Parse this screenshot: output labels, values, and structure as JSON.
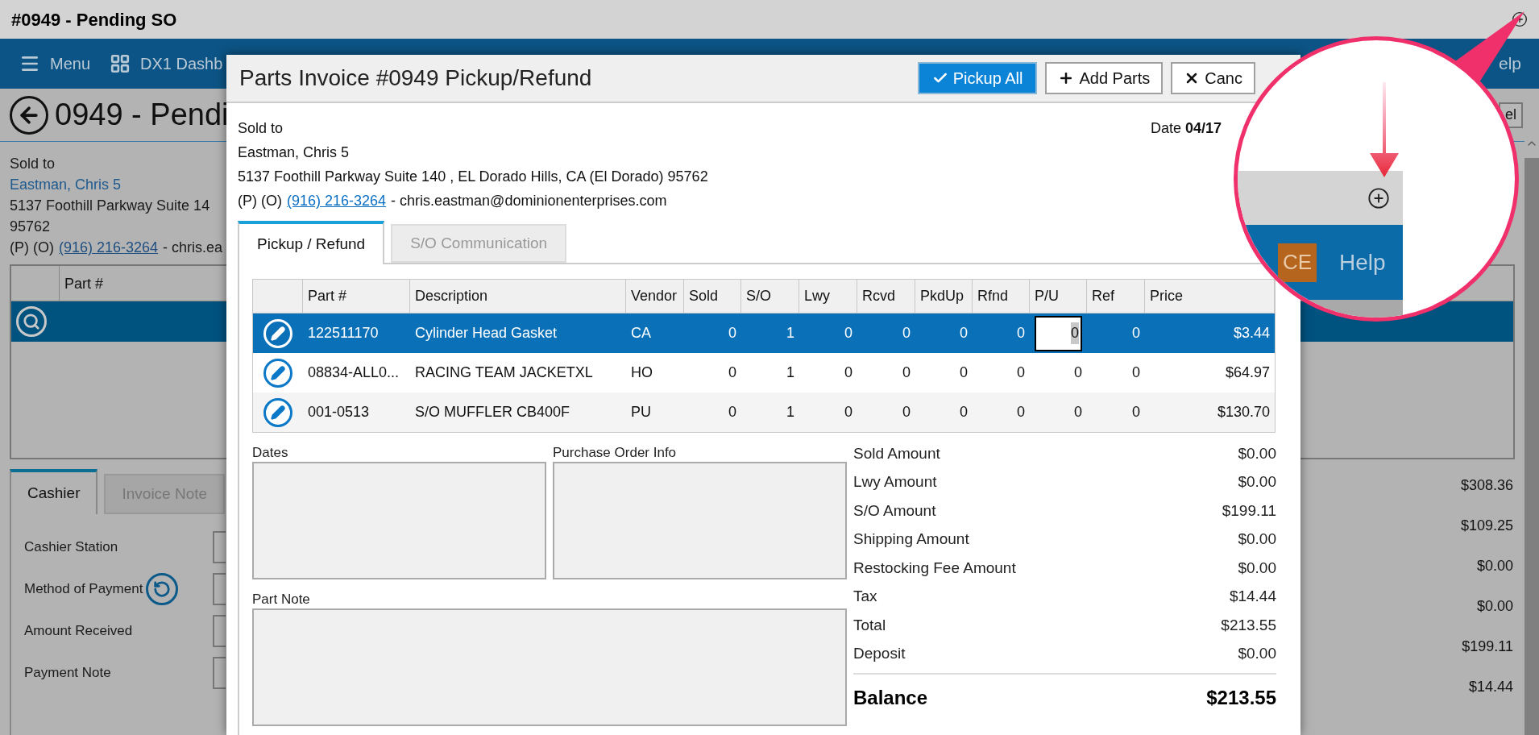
{
  "window": {
    "title": "#0949 - Pending SO"
  },
  "nav": {
    "items": [
      {
        "label": "Menu"
      },
      {
        "label": "DX1 Dashb"
      }
    ],
    "help_fragment": "elp"
  },
  "page": {
    "heading": "0949 - Pendi",
    "cancel_fragment": "el",
    "sold_to": {
      "label": "Sold to",
      "name": "Eastman, Chris 5",
      "address": "5137 Foothill Parkway Suite 14",
      "zip": "95762",
      "phone_prefix": "(P) (O)",
      "phone": "(916) 216-3264",
      "email": "- chris.ea"
    },
    "parts_table": {
      "columns": [
        "Part #"
      ]
    },
    "tabs": [
      {
        "label": "Cashier",
        "selected": true
      },
      {
        "label": "Invoice Note",
        "selected": false
      }
    ],
    "fields": [
      {
        "label": "Cashier Station",
        "kind": "plain"
      },
      {
        "label": "Method of Payment",
        "kind": "refresh"
      },
      {
        "label": "Amount Received",
        "kind": "plain"
      },
      {
        "label": "Payment Note",
        "kind": "plain"
      }
    ],
    "summary_values": [
      "$308.36",
      "$109.25",
      "$0.00",
      "$0.00",
      "$199.11",
      "$14.44"
    ]
  },
  "dialog": {
    "title": "Parts Invoice #0949 Pickup/Refund",
    "buttons": [
      {
        "label": "Pickup All",
        "primary": true
      },
      {
        "label": "Add Parts",
        "primary": false
      },
      {
        "label": "Canc",
        "primary": false
      }
    ],
    "sold_to": {
      "label": "Sold to",
      "name": "Eastman, Chris 5",
      "address": "5137 Foothill Parkway Suite 140 , EL Dorado Hills, CA (El Dorado) 95762",
      "phone_prefix": "(P) (O)",
      "phone": "(916) 216-3264",
      "email": "- chris.eastman@dominionenterprises.com"
    },
    "date": "Date **04/17**",
    "tabs": [
      {
        "label": "Pickup / Refund",
        "selected": true
      },
      {
        "label": "S/O Communication",
        "selected": false
      }
    ],
    "table": {
      "columns": [
        "Part #",
        "Description",
        "Vendor",
        "Sold",
        "S/O",
        "Lwy",
        "Rcvd",
        "PkdUp",
        "Rfnd",
        "P/U",
        "Ref",
        "Price"
      ],
      "rows": [
        {
          "selected": true,
          "cells": [
            "122511170",
            "Cylinder Head Gasket",
            "CA",
            "0",
            "1",
            "0",
            "0",
            "0",
            "0",
            "0",
            "0",
            "$3.44"
          ]
        },
        {
          "selected": false,
          "cells": [
            "08834-ALL0...",
            "RACING TEAM JACKETXL",
            "HO",
            "0",
            "1",
            "0",
            "0",
            "0",
            "0",
            "0",
            "0",
            "$64.97"
          ]
        },
        {
          "selected": false,
          "cells": [
            "001-0513",
            "S/O MUFFLER CB400F",
            "PU",
            "0",
            "1",
            "0",
            "0",
            "0",
            "0",
            "0",
            "0",
            "$130.70"
          ]
        }
      ]
    },
    "boxes": [
      {
        "label": "Dates"
      },
      {
        "label": "Purchase Order Info"
      }
    ],
    "part_note": {
      "label": "Part Note"
    },
    "totals": [
      {
        "label": "Sold Amount",
        "value": "$0.00"
      },
      {
        "label": "Lwy Amount",
        "value": "$0.00"
      },
      {
        "label": "S/O Amount",
        "value": "$199.11"
      },
      {
        "label": "Shipping Amount",
        "value": "$0.00"
      },
      {
        "label": "Restocking Fee Amount",
        "value": "$0.00"
      },
      {
        "label": "Tax",
        "value": "$14.44"
      },
      {
        "label": "Total",
        "value": "$213.55"
      },
      {
        "label": "Deposit",
        "value": "$0.00"
      }
    ],
    "balance": {
      "label": "Balance",
      "value": "$213.55"
    }
  },
  "magnifier": {
    "avatar": "CE",
    "help": "Help"
  }
}
